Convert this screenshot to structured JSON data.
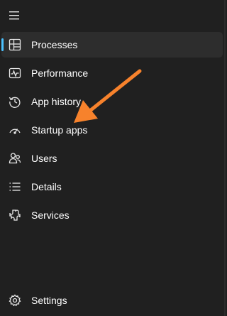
{
  "nav": {
    "items": [
      {
        "label": "Processes",
        "icon": "processes-icon",
        "selected": true
      },
      {
        "label": "Performance",
        "icon": "performance-icon"
      },
      {
        "label": "App history",
        "icon": "app-history-icon"
      },
      {
        "label": "Startup apps",
        "icon": "startup-apps-icon"
      },
      {
        "label": "Users",
        "icon": "users-icon"
      },
      {
        "label": "Details",
        "icon": "details-icon"
      },
      {
        "label": "Services",
        "icon": "services-icon"
      }
    ]
  },
  "footer": {
    "settings_label": "Settings"
  },
  "colors": {
    "background": "#202020",
    "selected_background": "#2d2d2d",
    "accent": "#4cc2ff",
    "annotation_arrow": "#f7822c"
  }
}
